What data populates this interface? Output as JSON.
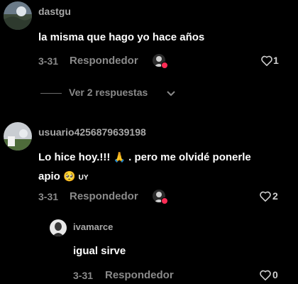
{
  "comments": [
    {
      "username": "dastgu",
      "text": "la misma que hago yo hace años",
      "date": "3-31",
      "reply_label": "Respondedor",
      "likes": "1",
      "view_replies": "Ver 2 respuestas"
    },
    {
      "username": "usuario4256879639198",
      "text_a": "Lo hice hoy.!!!",
      "emoji_a": "🙏",
      "text_b": ". pero me olvidé ponerle",
      "text_c": "apio",
      "emoji_b": "🥺",
      "tag": "UY",
      "date": "3-31",
      "reply_label": "Respondedor",
      "likes": "2"
    }
  ],
  "reply": {
    "username": "ivamarce",
    "text": "igual sirve",
    "date": "3-31",
    "reply_label": "Respondedor",
    "likes": "0"
  }
}
